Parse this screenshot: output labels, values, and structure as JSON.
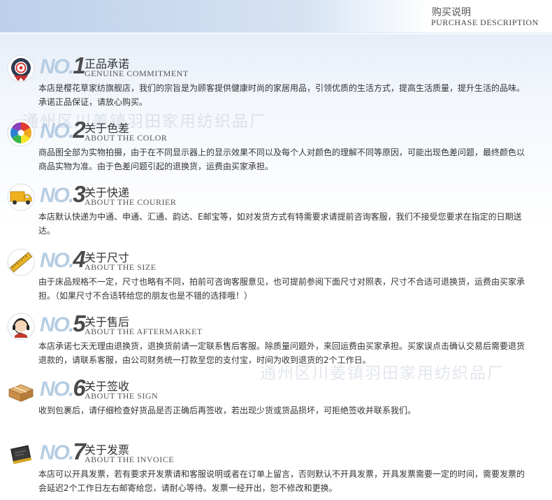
{
  "header": {
    "title": "购买说明",
    "subtitle": "PURCHASE DESCRIPTION"
  },
  "watermarks": [
    "通州区川姜镇羽田家用纺织品厂",
    "通州区川姜镇羽田家用纺织品厂"
  ],
  "no_label": "NO.",
  "sections": [
    {
      "number": "1",
      "title_cn": "正品承诺",
      "title_en": "GENUINE COMMITMENT",
      "icon": "seal-badge-icon",
      "text": "本店是樱花草家纺旗舰店，我们的宗旨是为顾客提供健康时尚的家居用品，引领优质的生活方式，提高生活质量，提升生活的品味。承诺正品保证，请放心购买。"
    },
    {
      "number": "2",
      "title_cn": "关于色差",
      "title_en": "ABOUT THE COLOR",
      "icon": "color-wheel-icon",
      "text": "商品图全部为实物拍摄，由于在不同显示器上的显示效果不同以及每个人对颜色的理解不同等原因，可能出现色差问题，最终颜色以商品实物为准。由于色差问题引起的退换货，运费由买家承担。"
    },
    {
      "number": "3",
      "title_cn": "关于快递",
      "title_en": "ABOUT THE COURIER",
      "icon": "delivery-truck-icon",
      "text": "本店默认快递为中通、申通、汇通、韵达、E邮宝等，如对发货方式有特需要求请提前咨询客服，我们不接受您要求在指定的日期送达。"
    },
    {
      "number": "4",
      "title_cn": "关于尺寸",
      "title_en": "ABOUT THE SIZE",
      "icon": "ruler-icon",
      "text": "由于床品规格不一定，尺寸也略有不同，拍前可咨询客服意见，也可提前参阅下面尺寸对照表，尺寸不合适可退换货，运费由买家承担。（如果尺寸不合适转给您的朋友也是不错的选择哦！）"
    },
    {
      "number": "5",
      "title_cn": "关于售后",
      "title_en": "ABOUT THE AFTERMARKET",
      "icon": "customer-service-headset-icon",
      "text": "本店承诺七天无理由退换货，退换货前请一定联系售后客服。除质量问题外，来回运费由买家承担。买家误点击确认交易后需要退货退款的，请联系客服，由公司财务统一打款至您的支付宝，时间为收到退货的2个工作日。"
    },
    {
      "number": "6",
      "title_cn": "关于签收",
      "title_en": "ABOUT THE SIGN",
      "icon": "package-box-icon",
      "text": "收到包裹后，请仔细检查好货品是否正确后再签收，若出现少货或货品损坏，可拒绝签收并联系我们。"
    },
    {
      "number": "7",
      "title_cn": "关于发票",
      "title_en": "ABOUT THE INVOICE",
      "icon": "invoice-book-icon",
      "text": "本店可以开具发票，若有要求开发票请和客服说明或者在订单上留言，否则默认不开具发票，开具发票需要一定的时间，需要发票的会延迟2个工作日左右邮寄给您，请耐心等待。发票一经开出，恕不修改和更换。"
    }
  ]
}
